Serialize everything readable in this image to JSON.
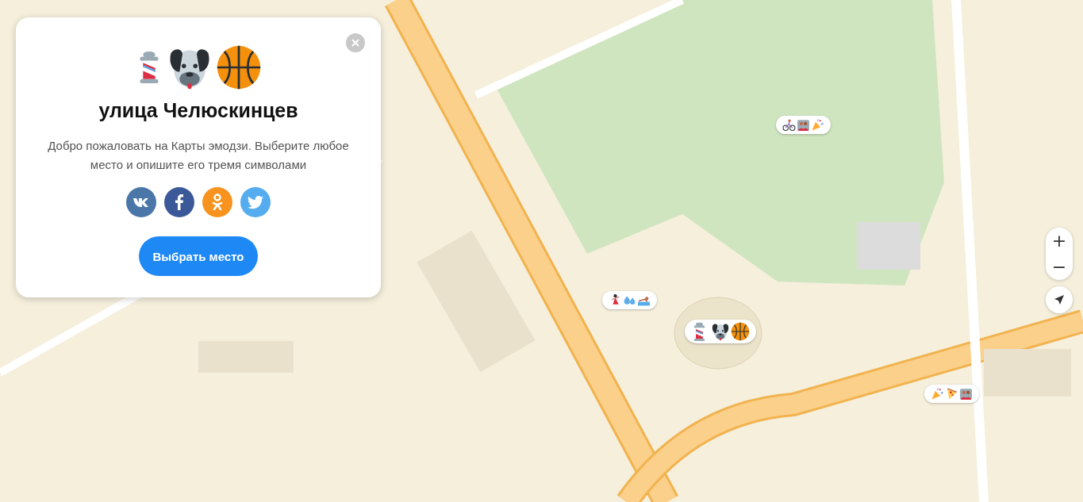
{
  "card": {
    "title": "улица Челюскинцев",
    "description": "Добро пожаловать на Карты эмодзи. Выберите любое место и опишите его тремя символами",
    "share_buttons": [
      {
        "kind": "vk",
        "color": "#4a76a8"
      },
      {
        "kind": "facebook",
        "color": "#3b5998"
      },
      {
        "kind": "ok",
        "color": "#f7931e"
      },
      {
        "kind": "twitter",
        "color": "#55acee"
      }
    ],
    "action": "Выбрать место"
  },
  "zoom": {
    "in": "+",
    "out": "−"
  }
}
